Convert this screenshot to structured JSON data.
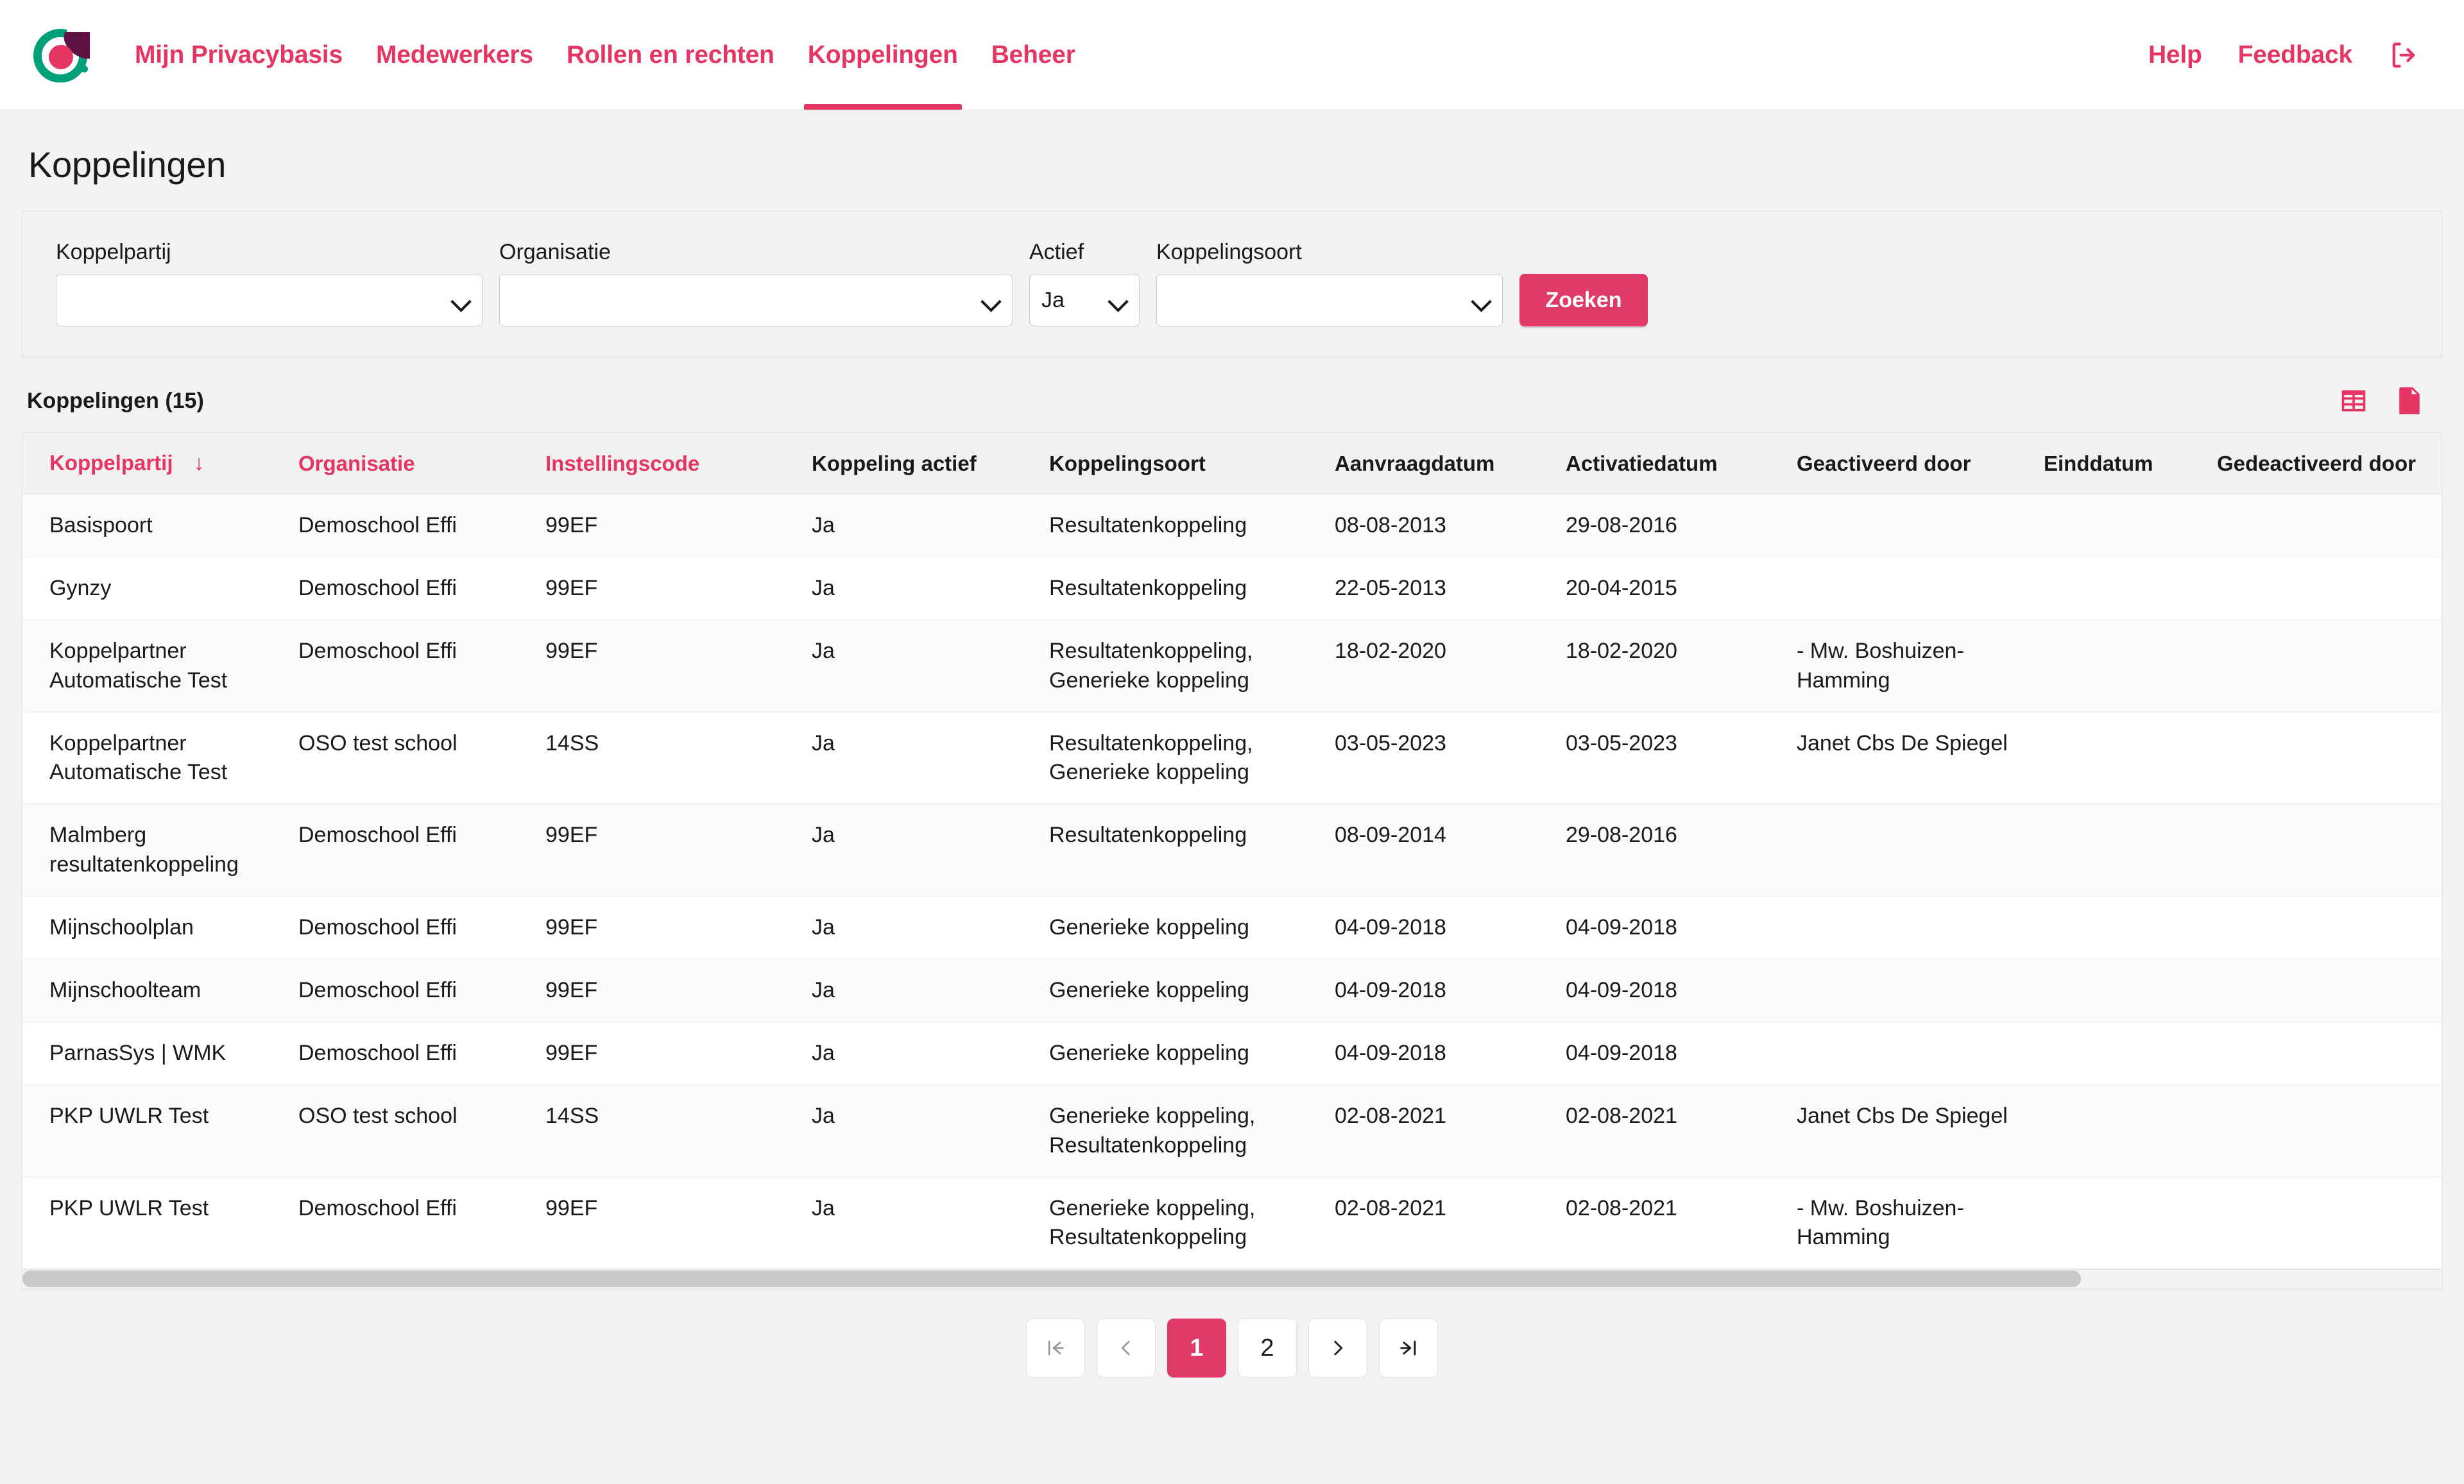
{
  "header": {
    "logo_name": "privacybasis-logo",
    "nav": [
      {
        "label": "Mijn Privacybasis",
        "active": false
      },
      {
        "label": "Medewerkers",
        "active": false
      },
      {
        "label": "Rollen en rechten",
        "active": false
      },
      {
        "label": "Koppelingen",
        "active": true
      },
      {
        "label": "Beheer",
        "active": false
      }
    ],
    "right_links": [
      {
        "label": "Help"
      },
      {
        "label": "Feedback"
      }
    ],
    "logout_icon": "logout-icon",
    "accent_color": "#e63463"
  },
  "page": {
    "title": "Koppelingen"
  },
  "filters": {
    "koppelpartij": {
      "label": "Koppelpartij",
      "value": ""
    },
    "organisatie": {
      "label": "Organisatie",
      "value": ""
    },
    "actief": {
      "label": "Actief",
      "value": "Ja"
    },
    "koppelingsoort": {
      "label": "Koppelingsoort",
      "value": ""
    },
    "search_button": "Zoeken"
  },
  "table": {
    "count_label": "Koppelingen (15)",
    "actions": [
      {
        "name": "table-view-icon"
      },
      {
        "name": "export-spreadsheet-icon"
      }
    ],
    "sort_column": "Koppelpartij",
    "sort_direction": "↓",
    "columns": [
      {
        "label": "Koppelpartij",
        "sortable": true
      },
      {
        "label": "Organisatie",
        "sortable": true
      },
      {
        "label": "Instellingscode",
        "sortable": true
      },
      {
        "label": "Koppeling actief",
        "sortable": false
      },
      {
        "label": "Koppelingsoort",
        "sortable": false
      },
      {
        "label": "Aanvraagdatum",
        "sortable": false
      },
      {
        "label": "Activatiedatum",
        "sortable": false
      },
      {
        "label": "Geactiveerd door",
        "sortable": false
      },
      {
        "label": "Einddatum",
        "sortable": false
      },
      {
        "label": "Gedeactiveerd door",
        "sortable": false
      }
    ],
    "rows": [
      {
        "koppelpartij": "Basispoort",
        "organisatie": "Demoschool Effi",
        "instellingscode": "99EF",
        "koppeling_actief": "Ja",
        "koppelingsoort": "Resultatenkoppeling",
        "aanvraagdatum": "08-08-2013",
        "activatiedatum": "29-08-2016",
        "geactiveerd_door": "",
        "einddatum": "",
        "gedeactiveerd_door": ""
      },
      {
        "koppelpartij": "Gynzy",
        "organisatie": "Demoschool Effi",
        "instellingscode": "99EF",
        "koppeling_actief": "Ja",
        "koppelingsoort": "Resultatenkoppeling",
        "aanvraagdatum": "22-05-2013",
        "activatiedatum": "20-04-2015",
        "geactiveerd_door": "",
        "einddatum": "",
        "gedeactiveerd_door": ""
      },
      {
        "koppelpartij": "Koppelpartner Automatische Test",
        "organisatie": "Demoschool Effi",
        "instellingscode": "99EF",
        "koppeling_actief": "Ja",
        "koppelingsoort": "Resultatenkoppeling, Generieke koppeling",
        "aanvraagdatum": "18-02-2020",
        "activatiedatum": "18-02-2020",
        "geactiveerd_door": "- Mw. Boshuizen-Hamming",
        "einddatum": "",
        "gedeactiveerd_door": ""
      },
      {
        "koppelpartij": "Koppelpartner Automatische Test",
        "organisatie": "OSO test school",
        "instellingscode": "14SS",
        "koppeling_actief": "Ja",
        "koppelingsoort": "Resultatenkoppeling, Generieke koppeling",
        "aanvraagdatum": "03-05-2023",
        "activatiedatum": "03-05-2023",
        "geactiveerd_door": "Janet Cbs De Spiegel",
        "einddatum": "",
        "gedeactiveerd_door": ""
      },
      {
        "koppelpartij": "Malmberg resultatenkoppeling",
        "organisatie": "Demoschool Effi",
        "instellingscode": "99EF",
        "koppeling_actief": "Ja",
        "koppelingsoort": "Resultatenkoppeling",
        "aanvraagdatum": "08-09-2014",
        "activatiedatum": "29-08-2016",
        "geactiveerd_door": "",
        "einddatum": "",
        "gedeactiveerd_door": ""
      },
      {
        "koppelpartij": "Mijnschoolplan",
        "organisatie": "Demoschool Effi",
        "instellingscode": "99EF",
        "koppeling_actief": "Ja",
        "koppelingsoort": "Generieke koppeling",
        "aanvraagdatum": "04-09-2018",
        "activatiedatum": "04-09-2018",
        "geactiveerd_door": "",
        "einddatum": "",
        "gedeactiveerd_door": ""
      },
      {
        "koppelpartij": "Mijnschoolteam",
        "organisatie": "Demoschool Effi",
        "instellingscode": "99EF",
        "koppeling_actief": "Ja",
        "koppelingsoort": "Generieke koppeling",
        "aanvraagdatum": "04-09-2018",
        "activatiedatum": "04-09-2018",
        "geactiveerd_door": "",
        "einddatum": "",
        "gedeactiveerd_door": ""
      },
      {
        "koppelpartij": "ParnasSys | WMK",
        "organisatie": "Demoschool Effi",
        "instellingscode": "99EF",
        "koppeling_actief": "Ja",
        "koppelingsoort": "Generieke koppeling",
        "aanvraagdatum": "04-09-2018",
        "activatiedatum": "04-09-2018",
        "geactiveerd_door": "",
        "einddatum": "",
        "gedeactiveerd_door": ""
      },
      {
        "koppelpartij": "PKP UWLR Test",
        "organisatie": "OSO test school",
        "instellingscode": "14SS",
        "koppeling_actief": "Ja",
        "koppelingsoort": "Generieke koppeling, Resultatenkoppeling",
        "aanvraagdatum": "02-08-2021",
        "activatiedatum": "02-08-2021",
        "geactiveerd_door": "Janet Cbs De Spiegel",
        "einddatum": "",
        "gedeactiveerd_door": ""
      },
      {
        "koppelpartij": "PKP UWLR Test",
        "organisatie": "Demoschool Effi",
        "instellingscode": "99EF",
        "koppeling_actief": "Ja",
        "koppelingsoort": "Generieke koppeling, Resultatenkoppeling",
        "aanvraagdatum": "02-08-2021",
        "activatiedatum": "02-08-2021",
        "geactiveerd_door": "- Mw. Boshuizen-Hamming",
        "einddatum": "",
        "gedeactiveerd_door": ""
      }
    ]
  },
  "pagination": {
    "first_icon": "first-page-icon",
    "prev_icon": "previous-page-icon",
    "next_icon": "next-page-icon",
    "last_icon": "last-page-icon",
    "pages": [
      "1",
      "2"
    ],
    "current_page": "1"
  }
}
